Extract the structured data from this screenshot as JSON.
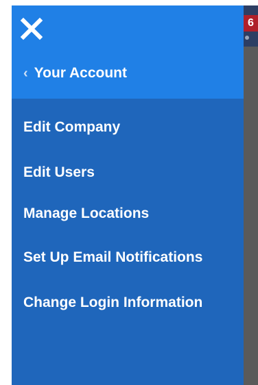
{
  "cart": {
    "badge_count": "6"
  },
  "drawer": {
    "close_icon": "close-icon",
    "back_icon": "chevron-left-icon",
    "back_label": "Your Account",
    "items": [
      {
        "label": "Edit Company"
      },
      {
        "label": "Edit Users"
      },
      {
        "label": "Manage Locations"
      },
      {
        "label": "Set Up Email Notifications"
      },
      {
        "label": "Change Login Information"
      }
    ]
  },
  "colors": {
    "drawer_bg": "#1f66bb",
    "drawer_header_bg": "#2080e6",
    "text": "#ffffff",
    "badge": "#b0202a",
    "overlay": "#5a5a5a"
  }
}
